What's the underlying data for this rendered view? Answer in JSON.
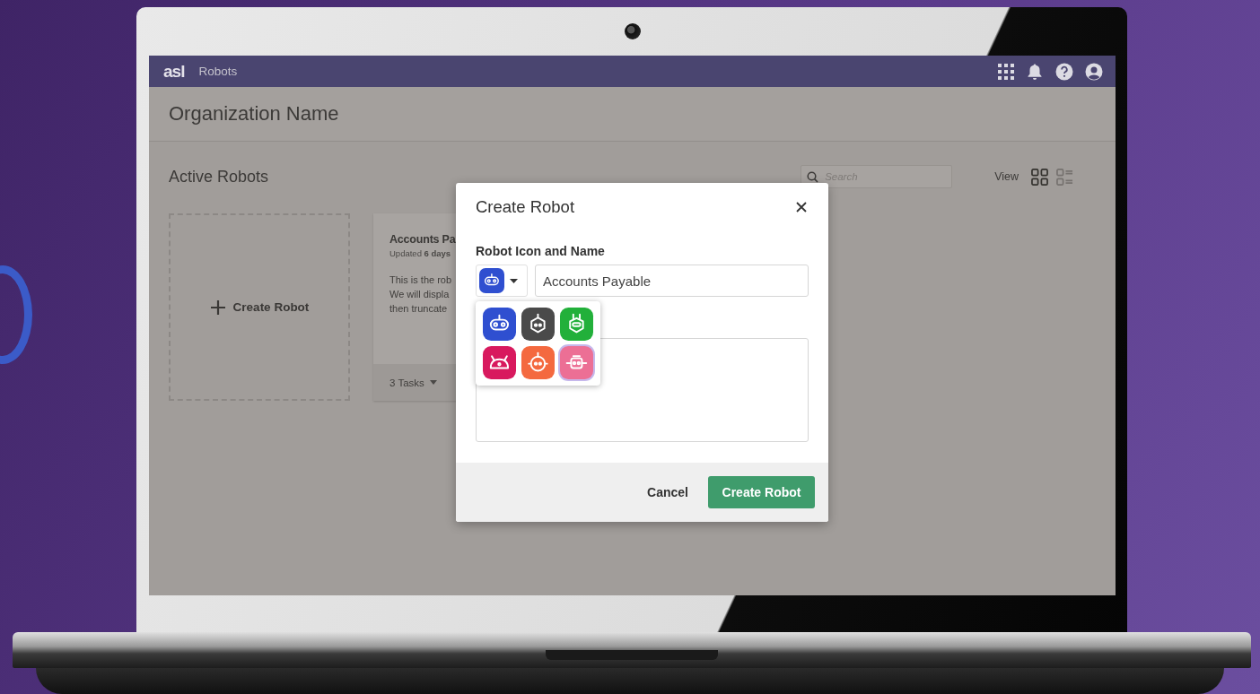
{
  "top_bar": {
    "logo": "asl",
    "app_name": "Robots"
  },
  "page_title": "Organization Name",
  "section": {
    "title": "Active Robots",
    "search": {
      "placeholder": "Search"
    },
    "view_label": "View",
    "view_options": [
      {
        "kind": "grid",
        "selected": true
      },
      {
        "kind": "list",
        "selected": false
      }
    ]
  },
  "cards": [
    {
      "kind": "create",
      "label": "Create Robot"
    },
    {
      "kind": "robot",
      "title": "Accounts Pa",
      "updated": "Updated **6 days**",
      "description": "This is the rob\nWe will displa\nthen truncate",
      "tasks": "3 Tasks"
    }
  ],
  "dialog": {
    "title": "Create Robot",
    "field_label": "Robot Icon and Name",
    "icon_picker": {
      "kind": "visor",
      "color": "#2f4fd0",
      "expanded": true
    },
    "name_field": {
      "value": "Accounts Payable"
    },
    "icon_options": [
      {
        "kind": "visor",
        "color": "#2f4fd0",
        "highlighted": false
      },
      {
        "kind": "hex",
        "color": "#4a4a4a",
        "highlighted": false
      },
      {
        "kind": "capsule",
        "color": "#22b03a",
        "highlighted": false
      },
      {
        "kind": "dome",
        "color": "#d8195e",
        "highlighted": false
      },
      {
        "kind": "round",
        "color": "#f4693f",
        "highlighted": false
      },
      {
        "kind": "boxy",
        "color": "#ec6f95",
        "highlighted": true
      }
    ],
    "buttons": [
      {
        "label": "Cancel",
        "kind": "secondary"
      },
      {
        "label": "Create Robot",
        "kind": "primary"
      }
    ]
  }
}
